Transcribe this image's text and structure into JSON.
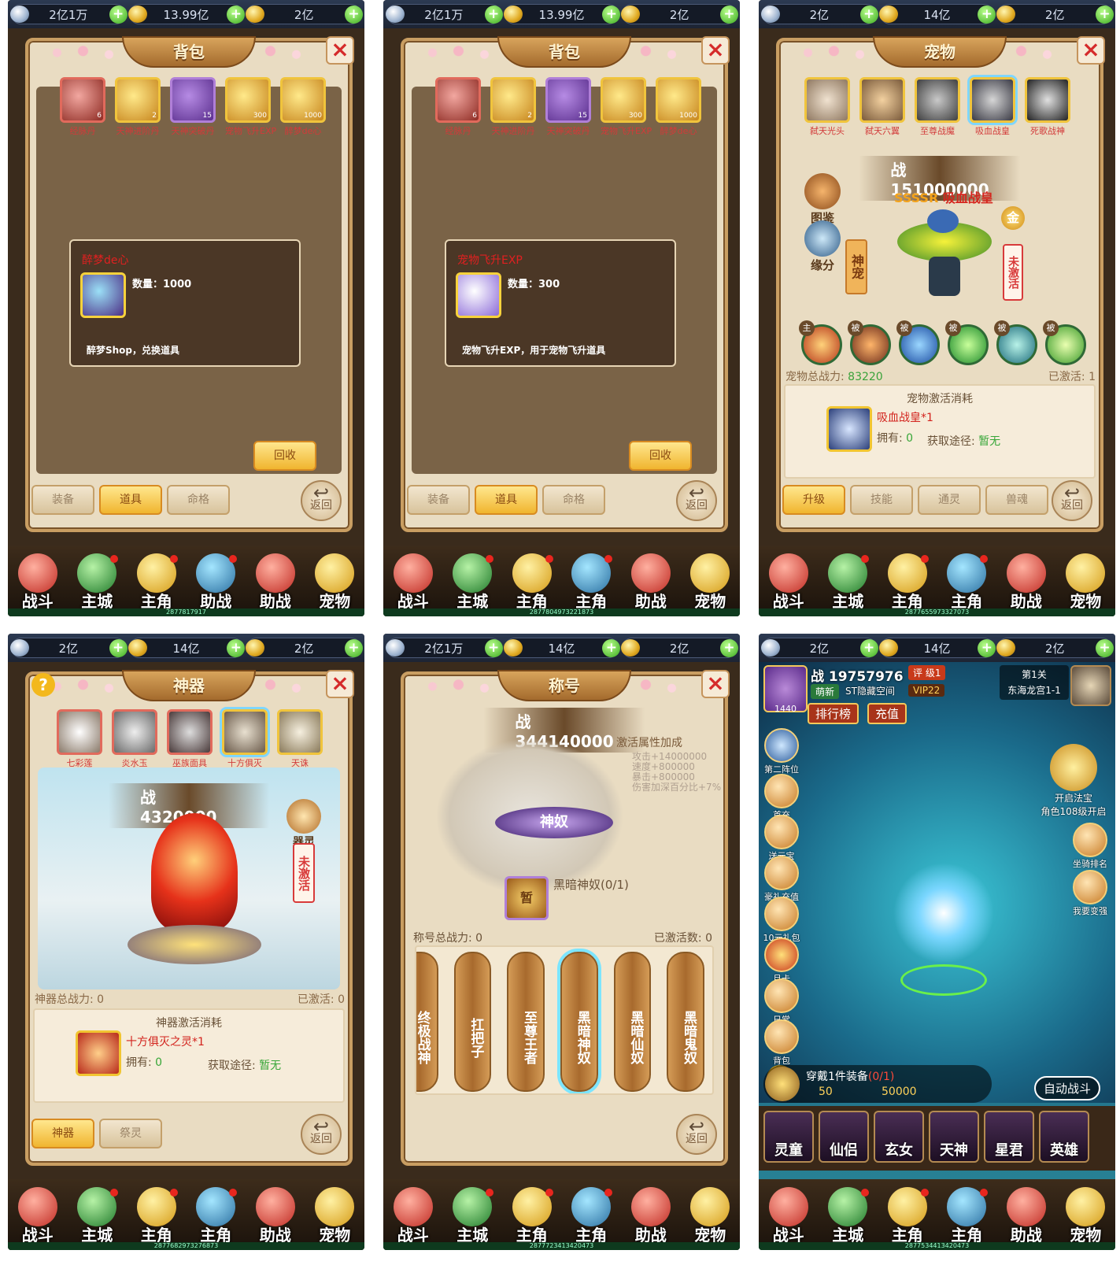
{
  "bag1": {
    "gold": "2亿1万",
    "ingot": "13.99亿",
    "gem": "2亿",
    "title": "背包",
    "items": [
      {
        "name": "经脉丹",
        "count": "6"
      },
      {
        "name": "天神进阶丹",
        "count": "2"
      },
      {
        "name": "天神突破丹",
        "count": "15"
      },
      {
        "name": "宠物飞升EXP",
        "count": "300"
      },
      {
        "name": "醉梦de心",
        "count": "1000"
      }
    ],
    "tooltip": {
      "title": "醉梦de心",
      "qty": "数量：1000",
      "desc": "醉梦Shop，兑换道具"
    },
    "recycle": "回收",
    "tabs": [
      "装备",
      "道具",
      "命格"
    ],
    "back": "返回",
    "nav": [
      "战斗",
      "主城",
      "主角",
      "助战",
      "助战",
      "宠物"
    ],
    "id": "2877817917"
  },
  "bag2": {
    "gold": "2亿1万",
    "ingot": "13.99亿",
    "gem": "2亿",
    "title": "背包",
    "items": [
      {
        "name": "经脉丹",
        "count": "6"
      },
      {
        "name": "天神进阶丹",
        "count": "2"
      },
      {
        "name": "天神突破丹",
        "count": "15"
      },
      {
        "name": "宠物飞升EXP",
        "count": "300"
      },
      {
        "name": "醉梦de心",
        "count": "1000"
      }
    ],
    "tooltip": {
      "title": "宠物飞升EXP",
      "qty": "数量：300",
      "desc": "宠物飞升EXP，用于宠物飞升道具"
    },
    "recycle": "回收",
    "tabs": [
      "装备",
      "道具",
      "命格"
    ],
    "back": "返回",
    "nav": [
      "战斗",
      "主城",
      "主角",
      "主角",
      "助战",
      "宠物"
    ],
    "id": "2877804973221873"
  },
  "pet": {
    "gold": "2亿",
    "ingot": "14亿",
    "gem": "2亿",
    "title": "宠物",
    "pets": [
      "弑天光头",
      "弑天六翼",
      "至尊战魔",
      "吸血战皇",
      "死歌战神"
    ],
    "power": "151000000",
    "rank": "SSSSR",
    "pet_name": "吸血战皇",
    "left_btns": [
      "图鉴",
      "缘分"
    ],
    "god_pet": "神宠",
    "coin": "金",
    "inactive": "未激活",
    "skill_tags": [
      "主",
      "被",
      "被",
      "被",
      "被",
      "被"
    ],
    "total_label": "宠物总战力:",
    "total": "83220",
    "activated": "已激活: 1",
    "cost_head": "宠物激活消耗",
    "cost_name": "吸血战皇",
    "cost_mul": "*1",
    "own_label": "拥有:",
    "own": "0",
    "src_label": "获取途径:",
    "src": "暂无",
    "tabs": [
      "升级",
      "技能",
      "通灵",
      "兽魂"
    ],
    "back": "返回",
    "nav": [
      "战斗",
      "主城",
      "主角",
      "主角",
      "助战",
      "宠物"
    ],
    "id": "2877655973327073"
  },
  "artifact": {
    "gold": "2亿",
    "ingot": "14亿",
    "gem": "2亿",
    "title": "神器",
    "arts": [
      "七彩莲",
      "炎水玉",
      "巫族面具",
      "十方俱灭",
      "天诛"
    ],
    "power": "4320000",
    "spirit": "器灵",
    "inactive": "未激活",
    "total_label": "神器总战力:",
    "total": "0",
    "activated": "已激活: 0",
    "cost_head": "神器激活消耗",
    "cost_name": "十方俱灭之灵",
    "cost_mul": "*1",
    "own_label": "拥有:",
    "own": "0",
    "src_label": "获取途径:",
    "src": "暂无",
    "tabs": [
      "神器",
      "祭灵"
    ],
    "back": "返回",
    "nav": [
      "战斗",
      "主城",
      "主角",
      "主角",
      "助战",
      "宠物"
    ],
    "id": "2877682973276873"
  },
  "titles": {
    "gold": "2亿1万",
    "ingot": "14亿",
    "gem": "2亿",
    "title": "称号",
    "power": "344140000",
    "bonus_head": "激活属性加成",
    "bonus": [
      "攻击+14000000",
      "速度+800000",
      "暴击+800000",
      "伤害加深百分比+7%"
    ],
    "emblem": "神奴",
    "cur": "黑暗神奴(0/1)",
    "cur_icon": "暂",
    "total_label": "称号总战力:",
    "total": "0",
    "activated": "已激活数: 0",
    "scrolls": [
      "终极战神",
      "扛把子",
      "至尊王者",
      "黑暗神奴",
      "黑暗仙奴",
      "黑暗鬼奴"
    ],
    "back": "返回",
    "nav": [
      "战斗",
      "主城",
      "主角",
      "主角",
      "助战",
      "宠物"
    ],
    "id": "2877723413420473"
  },
  "main": {
    "gold": "2亿",
    "ingot": "14亿",
    "gem": "2亿",
    "power": "19757976",
    "rating": "评 级1",
    "fresh": "萌新",
    "server": "ST隐藏空间",
    "vip": "VIP22",
    "level": "1440",
    "rank_btn": "排行榜",
    "charge_btn": "充值",
    "stage": "第1关",
    "map": "东海龙宫1-1",
    "left": [
      "第二阵位",
      "首充",
      "送元宝",
      "豪礼充值",
      "10元礼包",
      "月卡",
      "日常",
      "背包"
    ],
    "right": [
      "开启法宝",
      "角色108级开启",
      "坐骑排名",
      "我要变强"
    ],
    "quest": "穿戴1件装备",
    "quest_prog": "(0/1)",
    "reward1": "50",
    "reward2": "50000",
    "auto": "自动战斗",
    "heroes": [
      "灵童",
      "仙侣",
      "玄女",
      "天神",
      "星君",
      "英雄"
    ],
    "nav": [
      "战斗",
      "主城",
      "主角",
      "主角",
      "助战",
      "宠物"
    ],
    "id": "2877534413420473"
  }
}
